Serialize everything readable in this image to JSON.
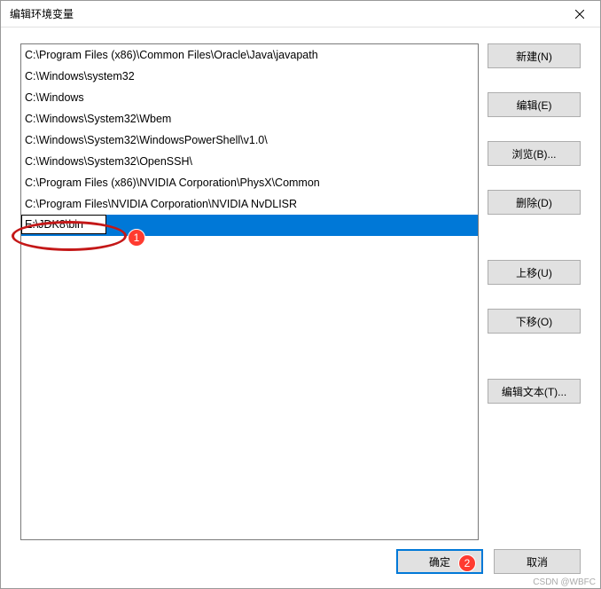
{
  "window": {
    "title": "编辑环境变量"
  },
  "list": {
    "items": [
      "C:\\Program Files (x86)\\Common Files\\Oracle\\Java\\javapath",
      "C:\\Windows\\system32",
      "C:\\Windows",
      "C:\\Windows\\System32\\Wbem",
      "C:\\Windows\\System32\\WindowsPowerShell\\v1.0\\",
      "C:\\Windows\\System32\\OpenSSH\\",
      "C:\\Program Files (x86)\\NVIDIA Corporation\\PhysX\\Common",
      "C:\\Program Files\\NVIDIA Corporation\\NVIDIA NvDLISR"
    ],
    "editing_value": "E:\\JDK8\\bin"
  },
  "buttons": {
    "new": "新建(N)",
    "edit": "编辑(E)",
    "browse": "浏览(B)...",
    "delete": "删除(D)",
    "move_up": "上移(U)",
    "move_down": "下移(O)",
    "edit_text": "编辑文本(T)...",
    "ok": "确定",
    "cancel": "取消"
  },
  "annotations": {
    "a1": "1",
    "a2": "2"
  },
  "watermark": "CSDN @WBFC"
}
